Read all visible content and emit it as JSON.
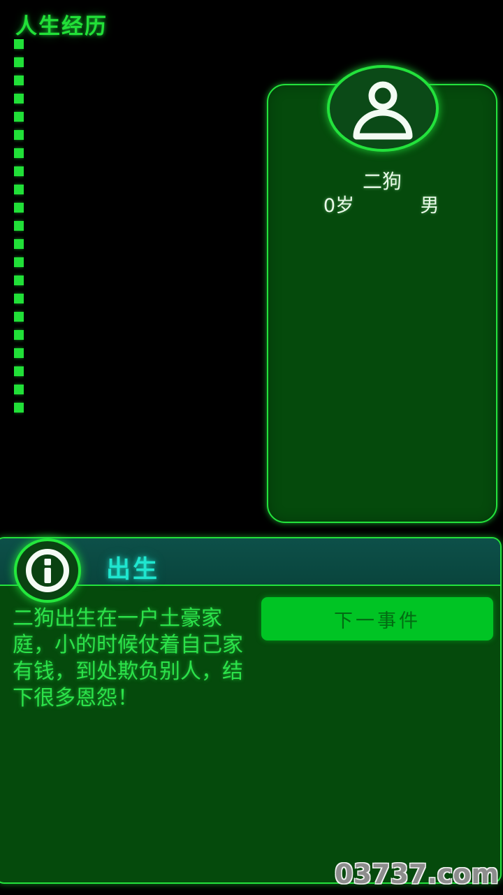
{
  "app": {
    "title": "人生经历"
  },
  "timeline": {
    "icon": "dashed-vertical-line",
    "dash_count": 21
  },
  "profile": {
    "avatar_icon": "person-avatar-icon",
    "name": "二狗",
    "age": "0岁",
    "gender": "男"
  },
  "event": {
    "icon": "info-circle-icon",
    "title": "出生",
    "description": "二狗出生在一户土豪家庭，小的时候仗着自己家有钱，到处欺负别人，结下很多恩怨！",
    "next_button_label": "下一事件"
  },
  "watermark": {
    "text": "03737.com"
  },
  "colors": {
    "background": "#000000",
    "accent_green": "#23e23c",
    "panel_green": "#054a0c",
    "header_teal": "#0a4a42",
    "title_cyan": "#1fe6cf",
    "button_green": "#00c424",
    "button_text": "#036b13",
    "body_text_green": "#2ce24a",
    "profile_text": "#eafbea",
    "watermark_gray": "#8d8d8d"
  }
}
